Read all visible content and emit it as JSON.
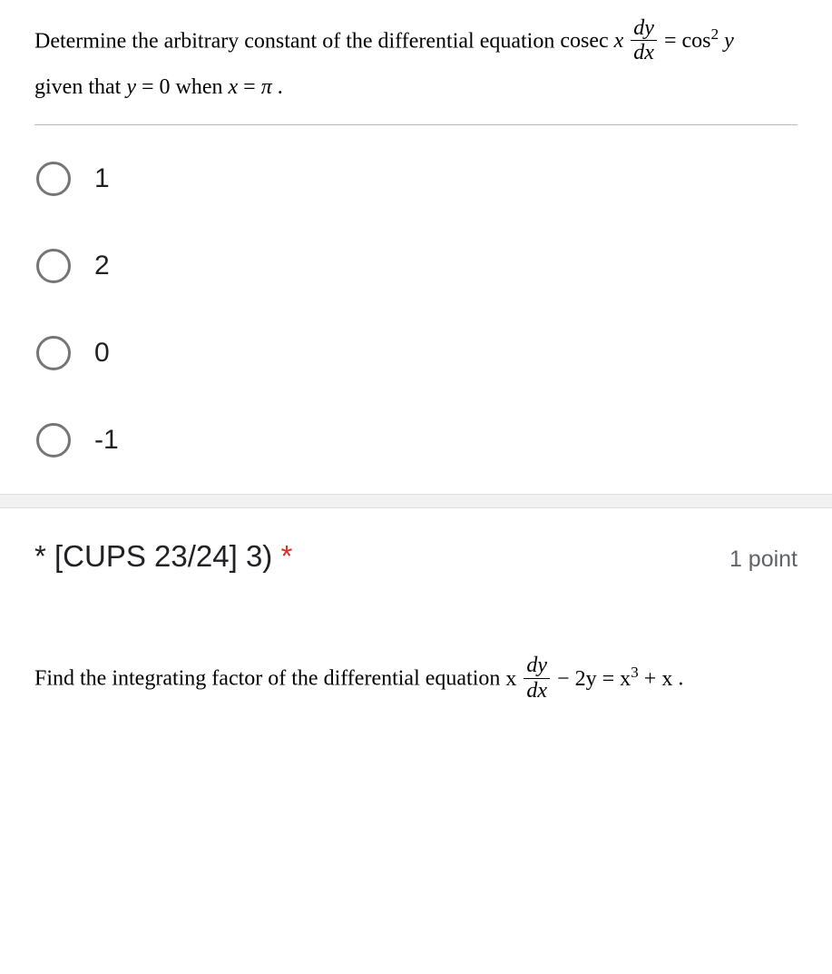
{
  "question1": {
    "prompt_pre": "Determine the arbitrary constant of the differential equation ",
    "eq_left_func": "cosec",
    "eq_left_var": "x",
    "frac_num": "dy",
    "frac_den": "dx",
    "eq_eq": " = ",
    "eq_rhs_func": "cos",
    "eq_rhs_exp": "2",
    "eq_rhs_var": " y",
    "prompt_line2_a": "given that ",
    "prompt_line2_b": "y",
    "prompt_line2_c": " = 0 when ",
    "prompt_line2_d": "x",
    "prompt_line2_e": " = ",
    "prompt_line2_f": "π",
    "prompt_line2_g": " .",
    "options": [
      "1",
      "2",
      "0",
      "-1"
    ]
  },
  "question2": {
    "title_pre": "* [CUPS 23/24] 3) ",
    "required_mark": "*",
    "points": "1 point",
    "prompt_pre": "Find the integrating factor of the differential equation  ",
    "eq_var1": "x",
    "frac_num": "dy",
    "frac_den": "dx",
    "eq_mid": " − 2",
    "eq_var2": "y",
    "eq_eq": " = ",
    "eq_var3": "x",
    "eq_exp": "3",
    "eq_plus": " + ",
    "eq_var4": "x",
    "eq_end": " ."
  }
}
